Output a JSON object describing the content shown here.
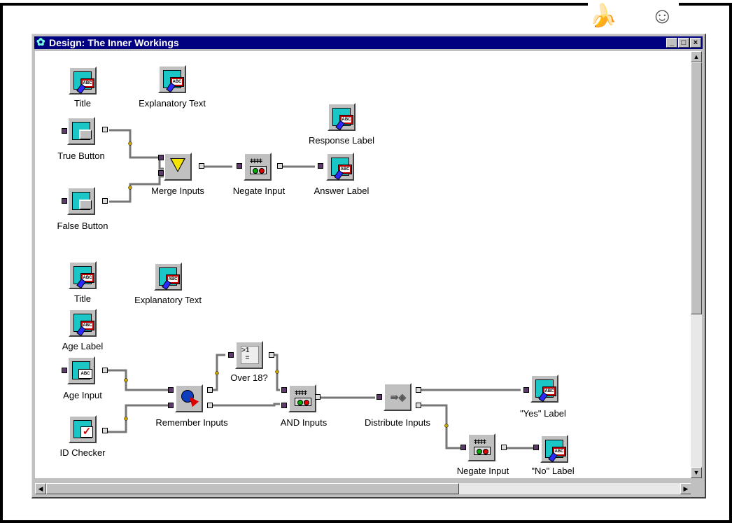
{
  "window": {
    "title": "Design: The Inner Workings",
    "title_icon": "gear-icon",
    "controls": [
      "_",
      "□",
      "×"
    ]
  },
  "top_section": {
    "components": [
      {
        "label": "Title",
        "icon": "text-label-icon"
      },
      {
        "label": "Explanatory Text",
        "icon": "text-label-icon"
      },
      {
        "label": "True Button",
        "icon": "push-button-icon"
      },
      {
        "label": "False Button",
        "icon": "push-button-icon"
      },
      {
        "label": "Merge Inputs",
        "icon": "merge-icon"
      },
      {
        "label": "Negate Input",
        "icon": "negate-icon"
      },
      {
        "label": "Response Label",
        "icon": "text-label-icon"
      },
      {
        "label": "Answer Label",
        "icon": "text-label-icon"
      }
    ]
  },
  "bottom_section": {
    "components": [
      {
        "label": "Title",
        "icon": "text-label-icon"
      },
      {
        "label": "Explanatory Text",
        "icon": "text-label-icon"
      },
      {
        "label": "Age Label",
        "icon": "text-label-icon"
      },
      {
        "label": "Age Input",
        "icon": "text-field-icon"
      },
      {
        "label": "ID Checker",
        "icon": "checkbox-icon"
      },
      {
        "label": "Remember Inputs",
        "icon": "remember-icon"
      },
      {
        "label": "Over 18?",
        "icon": "compare-icon"
      },
      {
        "label": "AND Inputs",
        "icon": "and-icon"
      },
      {
        "label": "Distribute Inputs",
        "icon": "distribute-icon"
      },
      {
        "label": "\"Yes\" Label",
        "icon": "text-label-icon"
      },
      {
        "label": "Negate Input",
        "icon": "negate-icon"
      },
      {
        "label": "\"No\" Label",
        "icon": "text-label-icon"
      }
    ]
  },
  "icon_text": {
    "abc": "ABC"
  },
  "colors": {
    "titlebar": "#000080",
    "component_face": "#1ac6c6",
    "text_badge": "#c00000",
    "wire": "#777777"
  }
}
